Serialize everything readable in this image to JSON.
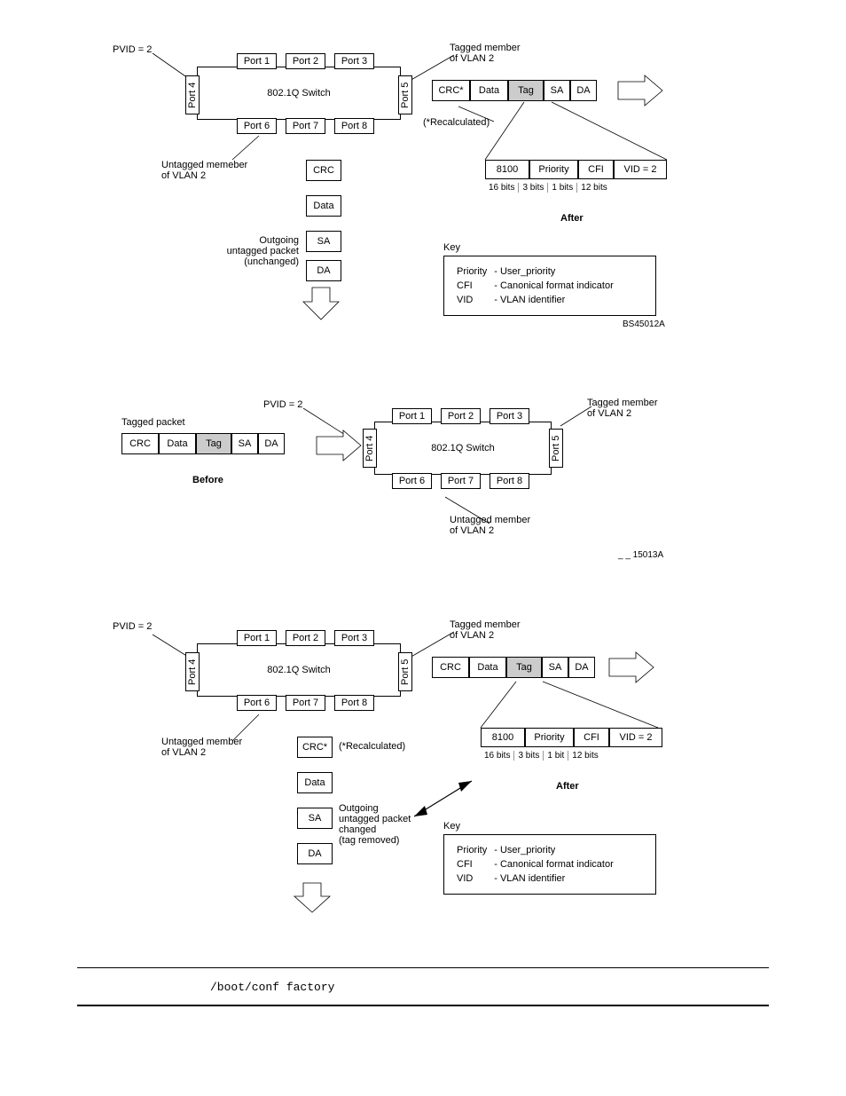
{
  "shared": {
    "pvid_label": "PVID = 2",
    "switch_label": "802.1Q Switch",
    "port1": "Port 1",
    "port2": "Port 2",
    "port3": "Port 3",
    "port4": "Port 4",
    "port5": "Port 5",
    "port6": "Port 6",
    "port7": "Port 7",
    "port8": "Port 8",
    "tagged_member": "Tagged member\nof VLAN 2",
    "untagged_member": "Untagged memeber\nof VLAN 2",
    "untagged_member2": "Untagged member\nof VLAN 2",
    "before": "Before",
    "after": "After",
    "key_title": "Key",
    "key_priority_l": "Priority",
    "key_priority_r": "- User_priority",
    "key_cfi_l": "CFI",
    "key_cfi_r": "- Canonical format indicator",
    "key_vid_l": "VID",
    "key_vid_r": "- VLAN identifier",
    "crc": "CRC",
    "crc_star": "CRC*",
    "data": "Data",
    "tag": "Tag",
    "sa": "SA",
    "da": "DA",
    "recalc": "(*Recalculated)",
    "tag_8100": "8100",
    "tag_priority": "Priority",
    "tag_cfi": "CFI",
    "tag_vid": "VID = 2",
    "bits16": "16 bits",
    "bits3": "3 bits",
    "bits1": "1 bits",
    "bits1b": "1 bit",
    "bits12": "12 bits"
  },
  "d1": {
    "outgoing": "Outgoing\nuntagged packet\n(unchanged)",
    "figid": "BS45012A"
  },
  "d2": {
    "tagged_packet": "Tagged packet",
    "figid": "_ _ 15013A"
  },
  "d3": {
    "outgoing": "Outgoing\nuntagged packet\nchanged\n(tag removed)"
  },
  "footer": {
    "code": "/boot/conf factory"
  }
}
